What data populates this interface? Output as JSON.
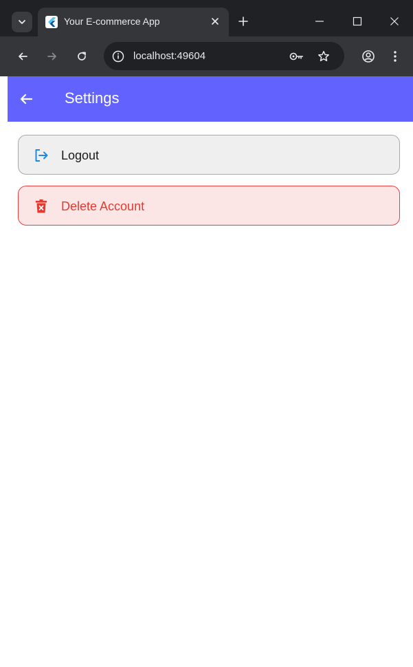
{
  "browser": {
    "tab": {
      "title": "Your E-commerce App"
    },
    "address_bar": {
      "url": "localhost:49604"
    },
    "icons": {
      "tab_search": "chevron-down-icon",
      "favicon": "flutter-icon",
      "tab_close": "close-icon",
      "new_tab": "plus-icon",
      "minimize": "minimize-icon",
      "maximize": "maximize-icon",
      "close_window": "close-icon",
      "back": "arrow-left-icon",
      "forward": "arrow-right-icon",
      "reload": "reload-icon",
      "site_info": "info-icon",
      "password": "key-icon",
      "bookmark": "star-icon",
      "profile": "profile-icon",
      "menu": "kebab-menu-icon"
    }
  },
  "app_bar": {
    "title": "Settings",
    "back_icon": "arrow-left-icon",
    "color": "#6262ff"
  },
  "settings": {
    "logout": {
      "label": "Logout",
      "icon": "logout-icon",
      "icon_color": "#1e88e5"
    },
    "delete_account": {
      "label": "Delete Account",
      "icon": "trash-icon",
      "color": "#e23a30"
    }
  }
}
